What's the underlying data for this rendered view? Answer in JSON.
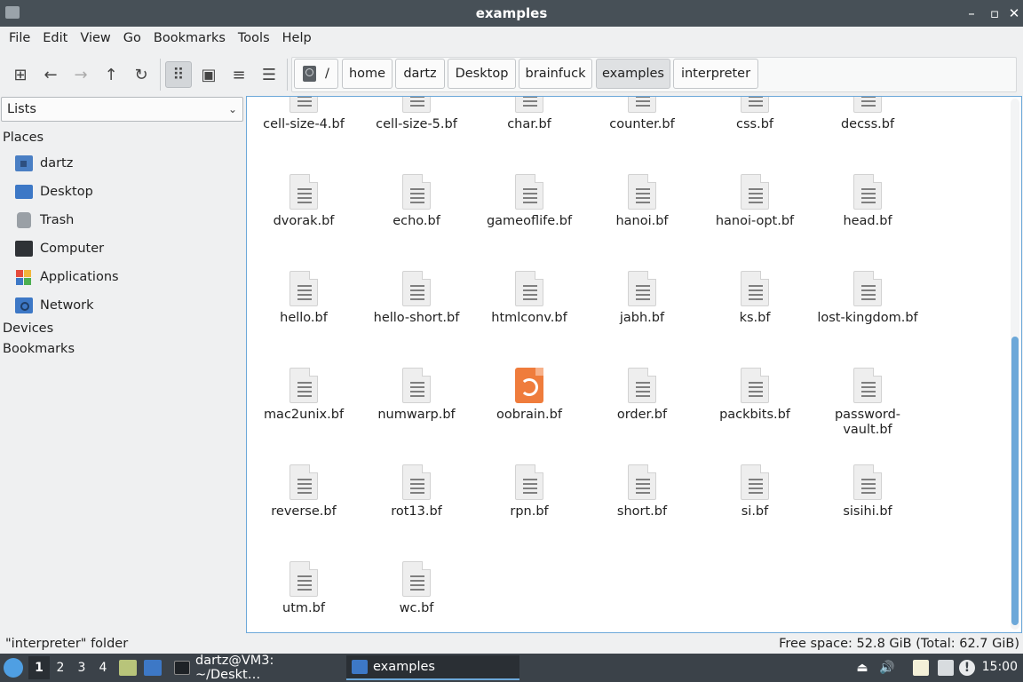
{
  "window": {
    "title": "examples"
  },
  "menu": [
    "File",
    "Edit",
    "View",
    "Go",
    "Bookmarks",
    "Tools",
    "Help"
  ],
  "breadcrumb": {
    "root": "/",
    "items": [
      "home",
      "dartz",
      "Desktop",
      "brainfuck",
      "examples",
      "interpreter"
    ],
    "active": "examples"
  },
  "sidebar": {
    "selector": "Lists",
    "places_heading": "Places",
    "places": [
      "dartz",
      "Desktop",
      "Trash",
      "Computer",
      "Applications",
      "Network"
    ],
    "devices_heading": "Devices",
    "bookmarks_heading": "Bookmarks"
  },
  "files": [
    "cell-size-4.bf",
    "cell-size-5.bf",
    "char.bf",
    "counter.bf",
    "css.bf",
    "decss.bf",
    "dvorak.bf",
    "echo.bf",
    "gameoflife.bf",
    "hanoi.bf",
    "hanoi-opt.bf",
    "head.bf",
    "hello.bf",
    "hello-short.bf",
    "htmlconv.bf",
    "jabh.bf",
    "ks.bf",
    "lost-kingdom.bf",
    "mac2unix.bf",
    "numwarp.bf",
    "oobrain.bf",
    "order.bf",
    "packbits.bf",
    "password-vault.bf",
    "reverse.bf",
    "rot13.bf",
    "rpn.bf",
    "short.bf",
    "si.bf",
    "sisihi.bf",
    "utm.bf",
    "wc.bf"
  ],
  "status": {
    "left": "\"interpreter\" folder",
    "right": "Free space: 52.8 GiB (Total: 62.7 GiB)"
  },
  "taskbar": {
    "desktops": [
      "1",
      "2",
      "3",
      "4"
    ],
    "tasks": [
      "dartz@VM3: ~/Deskt…",
      "examples"
    ],
    "clock": "15:00"
  },
  "colors": {
    "accent": "#6ca8d9",
    "titlebar": "#475057",
    "taskbar": "#3b4249"
  }
}
